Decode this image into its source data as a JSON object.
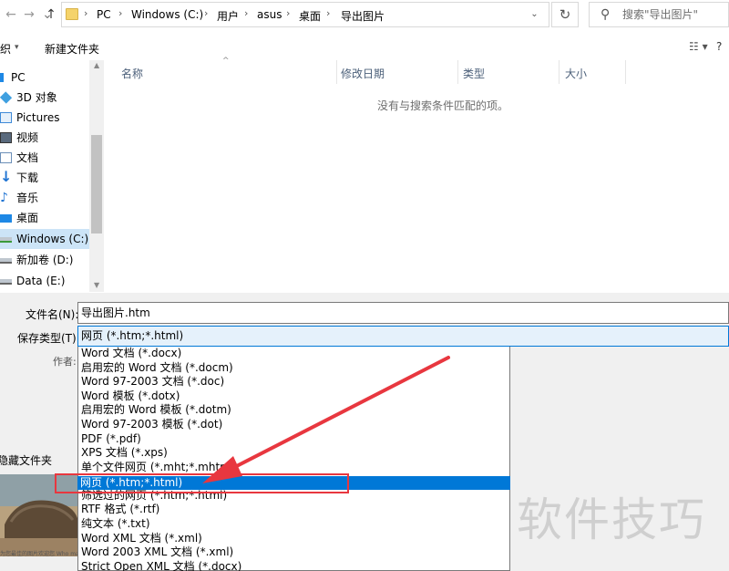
{
  "address": {
    "crumbs": [
      "PC",
      "Windows (C:)",
      "用户",
      "asus",
      "桌面",
      "导出图片"
    ],
    "search_placeholder": "搜索\"导出图片\""
  },
  "toolbar": {
    "organize_label": "组织",
    "new_folder_label": "新建文件夹"
  },
  "nav": {
    "items": [
      {
        "label": "PC",
        "icon": "computer-icon"
      },
      {
        "label": "3D 对象",
        "icon": "cube-icon"
      },
      {
        "label": "Pictures",
        "icon": "pictures-folder-icon"
      },
      {
        "label": "视频",
        "icon": "video-folder-icon"
      },
      {
        "label": "文档",
        "icon": "document-folder-icon"
      },
      {
        "label": "下载",
        "icon": "download-arrow-icon"
      },
      {
        "label": "音乐",
        "icon": "music-note-icon"
      },
      {
        "label": "桌面",
        "icon": "desktop-icon"
      },
      {
        "label": "Windows (C:)",
        "icon": "drive-icon"
      },
      {
        "label": "新加卷 (D:)",
        "icon": "drive-icon"
      },
      {
        "label": "Data (E:)",
        "icon": "drive-icon"
      }
    ],
    "selected_index": 8
  },
  "filelist": {
    "columns": [
      "名称",
      "修改日期",
      "类型",
      "大小"
    ],
    "empty_message": "没有与搜索条件匹配的项。"
  },
  "form": {
    "filename_label": "文件名(N):",
    "filename_value": "导出图片.htm",
    "savetype_label": "保存类型(T):",
    "savetype_value": "网页 (*.htm;*.html)",
    "author_label": "作者:",
    "hide_folders_label": "隐藏文件夹"
  },
  "dropdown": {
    "options": [
      "Word 文档 (*.docx)",
      "启用宏的 Word 文档 (*.docm)",
      "Word 97-2003 文档 (*.doc)",
      "Word 模板 (*.dotx)",
      "启用宏的 Word 模板 (*.dotm)",
      "Word 97-2003 模板 (*.dot)",
      "PDF (*.pdf)",
      "XPS 文档 (*.xps)",
      "单个文件网页 (*.mht;*.mhtml)",
      "网页 (*.htm;*.html)",
      "筛选过的网页 (*.htm;*.html)",
      "RTF 格式 (*.rtf)",
      "纯文本 (*.txt)",
      "Word XML 文档 (*.xml)",
      "Word 2003 XML 文档 (*.xml)",
      "Strict Open XML 文档 (*.docx)"
    ],
    "selected_index": 9
  },
  "overlay": {
    "watermark": "软件技巧",
    "thumb_caption": "为您最佳的图片欢迎您 Who made who you ..."
  },
  "colors": {
    "accent": "#0078d7",
    "selection_bg": "#cce4f7",
    "annotation_red": "#e8373f"
  }
}
